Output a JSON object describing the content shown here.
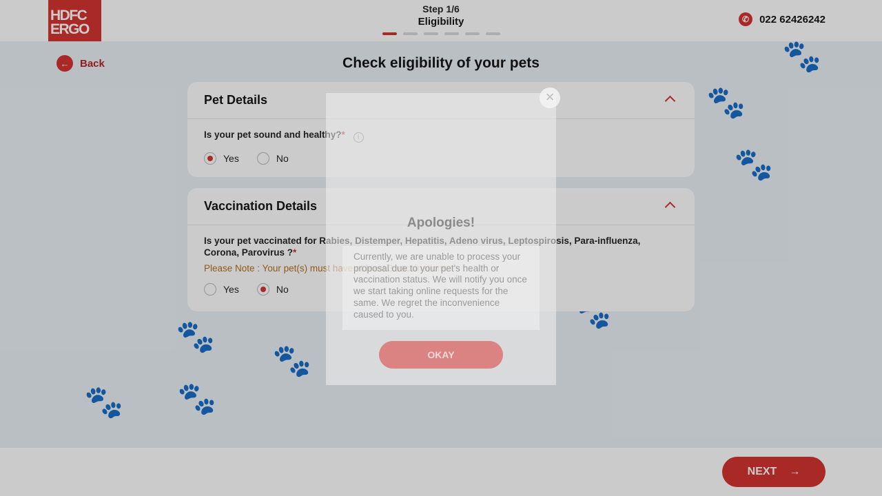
{
  "header": {
    "logo_line1": "HDFC",
    "logo_line2": "ERGO",
    "step_label": "Step 1/6",
    "step_title": "Eligibility",
    "step_total": 6,
    "step_current": 1,
    "phone": "022 62426242"
  },
  "nav": {
    "back_label": "Back"
  },
  "page_title": "Check eligibility of your pets",
  "pet_details": {
    "heading": "Pet Details",
    "question": "Is your pet sound and healthy?",
    "required_mark": "*",
    "options": [
      "Yes",
      "No"
    ],
    "selected": "Yes"
  },
  "vaccination": {
    "heading": "Vaccination Details",
    "question": "Is your pet vaccinated for Rabies, Distemper, Hepatitis, Adeno virus, Leptospirosis, Para-influenza, Corona, Parovirus ?",
    "required_mark": "*",
    "note": "Please Note : Your pet(s) must have at least 3 vaccinations",
    "options": [
      "Yes",
      "No"
    ],
    "selected": "No"
  },
  "footer": {
    "next_label": "NEXT"
  },
  "modal": {
    "title": "Apologies!",
    "message": "Currently, we are unable to process your proposal due to your pet's health or vaccination status. We will notify you once we start taking online requests for the same. We regret the inconvenience caused to you.",
    "ok_label": "OKAY",
    "close_symbol": "×"
  },
  "colors": {
    "brand_red": "#d3302b",
    "note_orange": "#b06e1c"
  }
}
